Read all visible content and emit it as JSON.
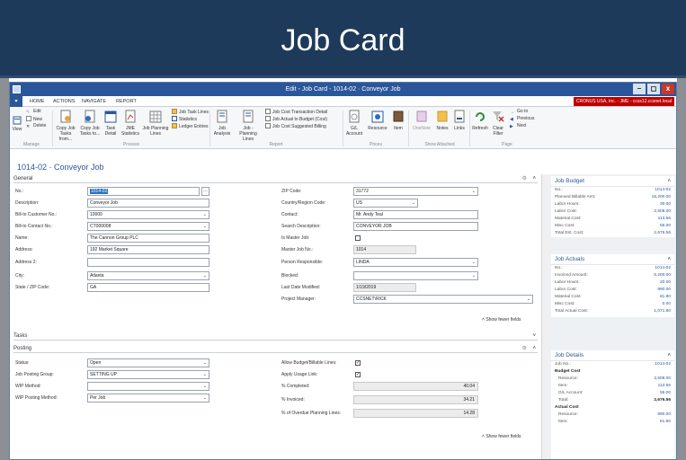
{
  "slide": {
    "title": "Job Card"
  },
  "window": {
    "title": "Edit - Job Card - 1014-02 · Conveyor Job",
    "controls": [
      "–",
      "◻",
      "x"
    ],
    "company": "CRONUS USA, Inc. - JME - ccss12.ccsnet.local"
  },
  "tabs": [
    "HOME",
    "ACTIONS",
    "NAVIGATE",
    "REPORT"
  ],
  "ribbon": {
    "manage": {
      "edit": "Edit",
      "new": "New",
      "delete": "Delete",
      "view": "View",
      "group": "Manage"
    },
    "process": {
      "copy_from": "Copy Job Tasks from...",
      "copy_to": "Copy Job Tasks to...",
      "task_detail": "Task Detail",
      "jme_stats": "JME Statistics",
      "planning_lines": "Job Planning Lines",
      "job_task_lines": "Job Task Lines",
      "statistics": "Statistics",
      "ledger_entries": "Ledger Entries",
      "group": "Process"
    },
    "report": {
      "job_analysis": "Job Analysis",
      "job_planning_lines": "Job - Planning Lines",
      "cost_transaction": "Job Cost Transaction Detail",
      "actual_to_budget": "Job Actual to Budget (Cost)",
      "cost_suggested": "Job Cost Suggested Billing",
      "group": "Report"
    },
    "prices": {
      "gl_account": "G/L Account",
      "resource": "Resource",
      "item": "Item",
      "group": "Prices"
    },
    "show_attached": {
      "onenote": "OneNote",
      "notes": "Notes",
      "links": "Links",
      "group": "Show Attached"
    },
    "page": {
      "refresh": "Refresh",
      "clear_filter": "Clear Filter",
      "goto": "Go to",
      "previous": "Previous",
      "next": "Next",
      "group": "Page"
    }
  },
  "page_heading": "1014-02 · Conveyor Job",
  "general": {
    "title": "General",
    "no_label": "No.:",
    "no_value": "1014-02",
    "description_label": "Description:",
    "description_value": "Conveyor Job",
    "bill_to_customer_label": "Bill-to Customer No.:",
    "bill_to_customer_value": "10000",
    "bill_to_contact_label": "Bill-to Contact No.:",
    "bill_to_contact_value": "CT000008",
    "name_label": "Name:",
    "name_value": "The Cannon Group PLC",
    "address_label": "Address:",
    "address_value": "192 Market Square",
    "address2_label": "Address 2:",
    "address2_value": "",
    "city_label": "City:",
    "city_value": "Atlanta",
    "state_zip_label": "State / ZIP Code:",
    "state_value": "GA",
    "zip_label": "ZIP Code:",
    "zip_value": "31772",
    "country_label": "Country/Region Code:",
    "country_value": "US",
    "contact_label": "Contact:",
    "contact_value": "Mr. Andy Teal",
    "search_desc_label": "Search Description:",
    "search_desc_value": "CONVEYOR JOB",
    "is_master_label": "Is Master Job:",
    "master_no_label": "Master Job No.:",
    "master_no_value": "1014",
    "person_resp_label": "Person Responsible:",
    "person_resp_value": "LINDA",
    "blocked_label": "Blocked:",
    "blocked_value": "",
    "last_modified_label": "Last Date Modified:",
    "last_modified_value": "1/19/2019",
    "project_manager_label": "Project Manager:",
    "project_manager_value": "CCSNET\\RICK",
    "show_fewer": "Show fewer fields"
  },
  "tasks": {
    "title": "Tasks"
  },
  "posting": {
    "title": "Posting",
    "status_label": "Status:",
    "status_value": "Open",
    "posting_group_label": "Job Posting Group:",
    "posting_group_value": "SETTING UP",
    "wip_method_label": "WIP Method:",
    "wip_method_value": "",
    "wip_posting_label": "WIP Posting Method:",
    "wip_posting_value": "Per Job",
    "allow_budget_label": "Allow Budget/Billable Lines:",
    "apply_usage_label": "Apply Usage Link:",
    "pct_completed_label": "% Completed:",
    "pct_completed_value": "40.04",
    "pct_invoiced_label": "% Invoiced:",
    "pct_invoiced_value": "34.21",
    "pct_overdue_label": "% of Overdue Planning Lines:",
    "pct_overdue_value": "14.28",
    "show_fewer": "Show fewer fields"
  },
  "factbox": {
    "budget": {
      "title": "Job Budget",
      "rows": [
        {
          "label": "No.:",
          "value": "1014-02"
        },
        {
          "label": "Planned Billable Amt:",
          "value": "15,200.00"
        },
        {
          "label": "Labor Hours:",
          "value": "30.00"
        },
        {
          "label": "Labor Cost:",
          "value": "2,508.00"
        },
        {
          "label": "Material Cost:",
          "value": "113.56"
        },
        {
          "label": "Misc Cost:",
          "value": "55.00"
        },
        {
          "label": "Total Est. Cost:",
          "value": "2,676.56"
        }
      ]
    },
    "actuals": {
      "title": "Job Actuals",
      "rows": [
        {
          "label": "No.:",
          "value": "1014-02"
        },
        {
          "label": "Invoiced Amount:",
          "value": "5,200.00"
        },
        {
          "label": "Labor Hours:",
          "value": "20.00"
        },
        {
          "label": "Labor Cost:",
          "value": "990.00"
        },
        {
          "label": "Material Cost:",
          "value": "81.80"
        },
        {
          "label": "Misc Cost:",
          "value": "0.00"
        },
        {
          "label": "Total Actual Cost:",
          "value": "1,071.80"
        }
      ]
    },
    "details": {
      "title": "Job Details",
      "job_no_label": "Job No.:",
      "job_no_value": "1014-02",
      "budget_cost_label": "Budget Cost",
      "budget_rows": [
        {
          "label": "Resource:",
          "value": "2,508.00"
        },
        {
          "label": "Item:",
          "value": "113.56"
        },
        {
          "label": "G/L Account:",
          "value": "55.00"
        },
        {
          "label": "Total:",
          "value": "2,676.56"
        }
      ],
      "actual_cost_label": "Actual Cost",
      "actual_rows": [
        {
          "label": "Resource:",
          "value": "990.00"
        },
        {
          "label": "Item:",
          "value": "81.80"
        }
      ]
    }
  },
  "colors": {
    "accent": "#2b579a",
    "slide_bg": "#1d3a5a",
    "company_badge": "#c00000"
  }
}
